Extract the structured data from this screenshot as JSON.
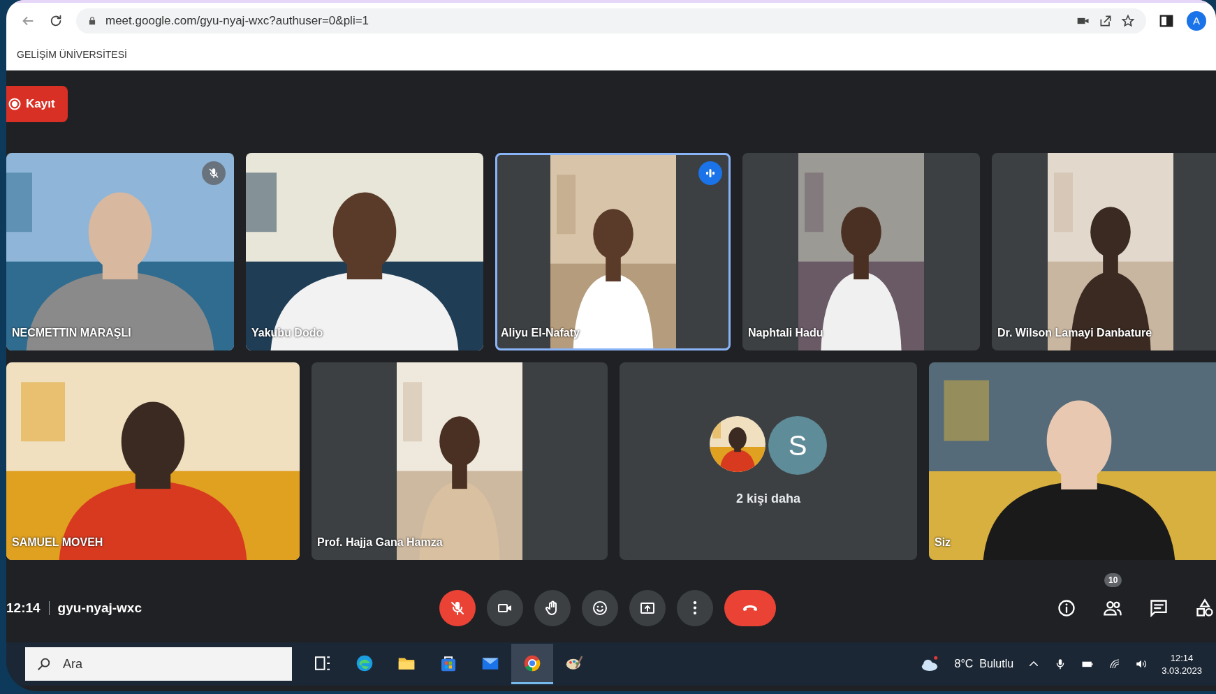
{
  "browser": {
    "url": "meet.google.com/gyu-nyaj-wxc?authuser=0&pli=1",
    "profile_initial": "A"
  },
  "bookmarks": [
    "GELİŞİM ÜNİVERSİTESİ"
  ],
  "recording": {
    "label": "Kayıt"
  },
  "tile_rows": [
    [
      {
        "kind": "video",
        "name": "NECMETTIN MARAŞLI",
        "muted": true,
        "speaking": false
      },
      {
        "kind": "video",
        "name": "Yakubu Dodo",
        "muted": false,
        "speaking": false
      },
      {
        "kind": "portrait_video",
        "name": "Aliyu El-Nafaty",
        "muted": false,
        "speaking": true
      },
      {
        "kind": "portrait_video",
        "name": "Naphtali Hadu",
        "muted": false,
        "speaking": false
      },
      {
        "kind": "portrait_video",
        "name": "Dr. Wilson Lamayi Danbature",
        "muted": false,
        "speaking": false
      }
    ],
    [
      {
        "kind": "video",
        "name": "SAMUEL MOVEH",
        "muted": false,
        "speaking": false
      },
      {
        "kind": "portrait_video",
        "name": "Prof. Hajja Gana Hamza",
        "muted": false,
        "speaking": false
      },
      {
        "kind": "more",
        "label": "2 kişi daha",
        "avatar_letter": "S"
      },
      {
        "kind": "video",
        "name": "Siz",
        "muted": false,
        "speaking": false
      }
    ]
  ],
  "meeting": {
    "time": "12:14",
    "code": "gyu-nyaj-wxc"
  },
  "controls": [
    {
      "kind": "mic",
      "muted": true
    },
    {
      "kind": "camera"
    },
    {
      "kind": "hand"
    },
    {
      "kind": "emoji"
    },
    {
      "kind": "present"
    },
    {
      "kind": "more"
    },
    {
      "kind": "end"
    }
  ],
  "side_controls": [
    {
      "kind": "info"
    },
    {
      "kind": "people",
      "badge": "10"
    },
    {
      "kind": "chat"
    },
    {
      "kind": "activities"
    }
  ],
  "taskbar": {
    "search_placeholder": "Ara",
    "apps": [
      {
        "kind": "taskview",
        "selected": false
      },
      {
        "kind": "edge",
        "selected": false
      },
      {
        "kind": "files",
        "selected": false
      },
      {
        "kind": "store",
        "selected": false
      },
      {
        "kind": "mail",
        "selected": false
      },
      {
        "kind": "chrome",
        "selected": true
      },
      {
        "kind": "paint",
        "selected": false
      }
    ],
    "weather": "8°C  Bulutlu",
    "time": "12:14",
    "date": "3.03.2023"
  }
}
